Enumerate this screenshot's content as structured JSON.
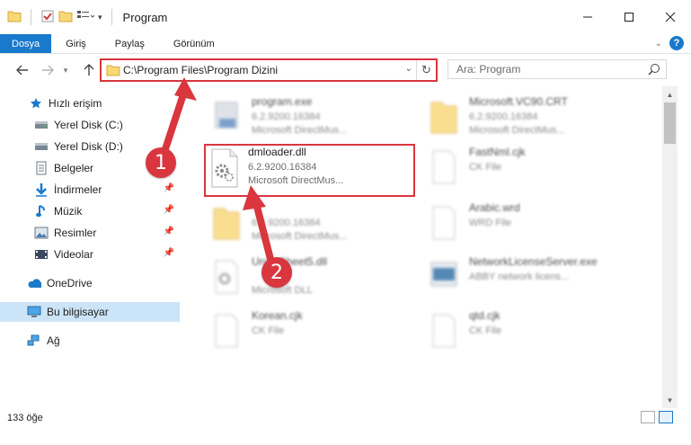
{
  "window": {
    "title": "Program"
  },
  "ribbon": {
    "tabs": [
      "Dosya",
      "Giriş",
      "Paylaş",
      "Görünüm"
    ]
  },
  "address": {
    "path": "C:\\Program Files\\Program Dizini"
  },
  "search": {
    "placeholder": "Ara: Program"
  },
  "sidebar": {
    "items": [
      {
        "label": "Hızlı erişim",
        "icon": "star-icon"
      },
      {
        "label": "Yerel Disk (C:)",
        "icon": "drive-icon"
      },
      {
        "label": "Yerel Disk (D:)",
        "icon": "drive-icon"
      },
      {
        "label": "Belgeler",
        "icon": "documents-icon"
      },
      {
        "label": "İndirmeler",
        "icon": "download-icon"
      },
      {
        "label": "Müzik",
        "icon": "music-icon"
      },
      {
        "label": "Resimler",
        "icon": "pictures-icon"
      },
      {
        "label": "Videolar",
        "icon": "videos-icon"
      },
      {
        "label": "OneDrive",
        "icon": "cloud-icon"
      },
      {
        "label": "Bu bilgisayar",
        "icon": "computer-icon"
      },
      {
        "label": "Ağ",
        "icon": "network-icon"
      }
    ]
  },
  "files": [
    {
      "name": "program.exe",
      "line2": "6.2.9200.16384",
      "line3": "Microsoft DirectMus..."
    },
    {
      "name": "Microsoft.VC90.CRT",
      "line2": "6.2.9200.16384",
      "line3": "Microsoft DirectMus..."
    },
    {
      "name": "dmloader.dll",
      "line2": "6.2.9200.16384",
      "line3": "Microsoft DirectMus..."
    },
    {
      "name": "FastNml.cjk",
      "line2": "CK File",
      "line3": ""
    },
    {
      "name": "",
      "line2": "6.2.9200.16384",
      "line3": "Microsoft DirectMus..."
    },
    {
      "name": "Arabic.wrd",
      "line2": "WRD File",
      "line3": ""
    },
    {
      "name": "UnicoSheet5.dll",
      "line2": "",
      "line3": "Microsoft DLL"
    },
    {
      "name": "NetworkLicenseServer.exe",
      "line2": "ABBY network licens...",
      "line3": ""
    },
    {
      "name": "Korean.cjk",
      "line2": "CK File",
      "line3": ""
    },
    {
      "name": "qtd.cjk",
      "line2": "CK File",
      "line3": ""
    }
  ],
  "status": {
    "count": "133 öğe"
  },
  "annotations": {
    "badge1": "1",
    "badge2": "2"
  },
  "colors": {
    "accent": "#1979ca",
    "highlight": "#d9363e"
  }
}
